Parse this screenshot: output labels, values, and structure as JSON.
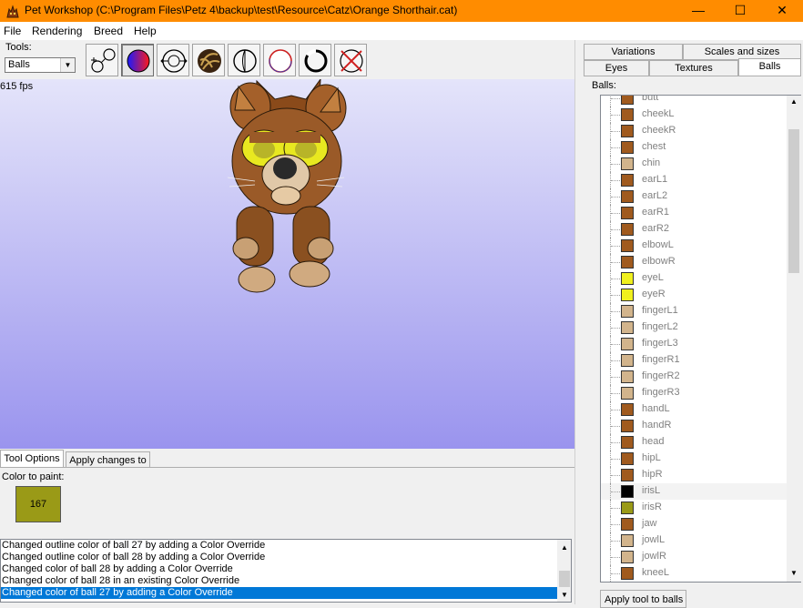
{
  "window": {
    "title": "Pet Workshop (C:\\Program Files\\Petz 4\\backup\\test\\Resource\\Catz\\Orange Shorthair.cat)",
    "minimize": "—",
    "maximize": "☐",
    "close": "✕"
  },
  "menu": [
    "File",
    "Rendering",
    "Breed",
    "Help"
  ],
  "tools": {
    "label": "Tools:",
    "selected": "Balls",
    "buttons": [
      {
        "name": "connect-balls-tool"
      },
      {
        "name": "paint-color-tool"
      },
      {
        "name": "resize-ball-tool"
      },
      {
        "name": "texture-tool"
      },
      {
        "name": "fuzz-tool"
      },
      {
        "name": "outline-color-tool"
      },
      {
        "name": "outline-width-tool"
      },
      {
        "name": "delete-ball-tool"
      }
    ]
  },
  "viewport": {
    "fps": "615 fps"
  },
  "lower_tabs": {
    "tool_options": "Tool Options",
    "apply_changes": "Apply changes to"
  },
  "tool_options": {
    "color_label": "Color to paint:",
    "color_value": "167",
    "color_hex": "#9a9a17"
  },
  "log": [
    "Changed outline color of ball 27 by adding a Color Override",
    "Changed outline color of ball 28 by adding a Color Override",
    "Changed color of ball 28 by adding a Color Override",
    "Changed color of ball 28 in an existing Color Override",
    "Changed color of ball 27 by adding a Color Override"
  ],
  "right_tabs": {
    "variations": "Variations",
    "scales": "Scales and sizes",
    "eyes": "Eyes",
    "textures": "Textures",
    "balls": "Balls"
  },
  "balls_label": "Balls:",
  "balls": [
    {
      "name": "butt",
      "color": "#a05a1e"
    },
    {
      "name": "cheekL",
      "color": "#a05a1e"
    },
    {
      "name": "cheekR",
      "color": "#a05a1e"
    },
    {
      "name": "chest",
      "color": "#a05a1e"
    },
    {
      "name": "chin",
      "color": "#d2b48c"
    },
    {
      "name": "earL1",
      "color": "#a05a1e"
    },
    {
      "name": "earL2",
      "color": "#a05a1e"
    },
    {
      "name": "earR1",
      "color": "#a05a1e"
    },
    {
      "name": "earR2",
      "color": "#a05a1e"
    },
    {
      "name": "elbowL",
      "color": "#a05a1e"
    },
    {
      "name": "elbowR",
      "color": "#a05a1e"
    },
    {
      "name": "eyeL",
      "color": "#f0f01e"
    },
    {
      "name": "eyeR",
      "color": "#f0f01e"
    },
    {
      "name": "fingerL1",
      "color": "#d2b48c"
    },
    {
      "name": "fingerL2",
      "color": "#d2b48c"
    },
    {
      "name": "fingerL3",
      "color": "#d2b48c"
    },
    {
      "name": "fingerR1",
      "color": "#d2b48c"
    },
    {
      "name": "fingerR2",
      "color": "#d2b48c"
    },
    {
      "name": "fingerR3",
      "color": "#d2b48c"
    },
    {
      "name": "handL",
      "color": "#a05a1e"
    },
    {
      "name": "handR",
      "color": "#a05a1e"
    },
    {
      "name": "head",
      "color": "#a05a1e"
    },
    {
      "name": "hipL",
      "color": "#a05a1e"
    },
    {
      "name": "hipR",
      "color": "#a05a1e"
    },
    {
      "name": "irisL",
      "color": "#000000"
    },
    {
      "name": "irisR",
      "color": "#9a9a17"
    },
    {
      "name": "jaw",
      "color": "#a05a1e"
    },
    {
      "name": "jowlL",
      "color": "#d2b48c"
    },
    {
      "name": "jowlR",
      "color": "#d2b48c"
    },
    {
      "name": "kneeL",
      "color": "#a05a1e"
    }
  ],
  "apply_tool_button": "Apply tool to balls"
}
